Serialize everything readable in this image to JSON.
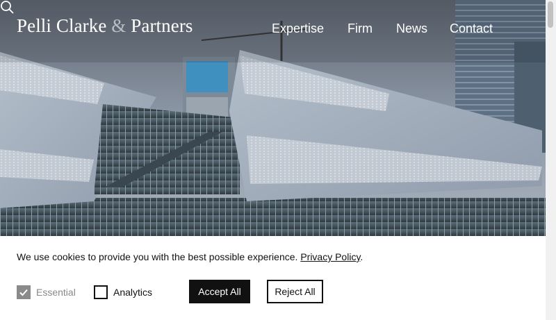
{
  "header": {
    "logo_part1": "Pelli Clarke",
    "logo_amp": "&",
    "logo_part2": "Partners",
    "nav": [
      "Expertise",
      "Firm",
      "News",
      "Contact"
    ],
    "search_icon": "search-icon"
  },
  "cookie_banner": {
    "message": "We use cookies to provide you with the best possible experience.",
    "policy_link": "Privacy Policy",
    "period": ".",
    "essential_label": "Essential",
    "essential_checked": true,
    "analytics_label": "Analytics",
    "analytics_checked": false,
    "accept_label": "Accept All",
    "reject_label": "Reject All"
  },
  "colors": {
    "accent": "#111111",
    "disabled": "#8a8a8a"
  }
}
